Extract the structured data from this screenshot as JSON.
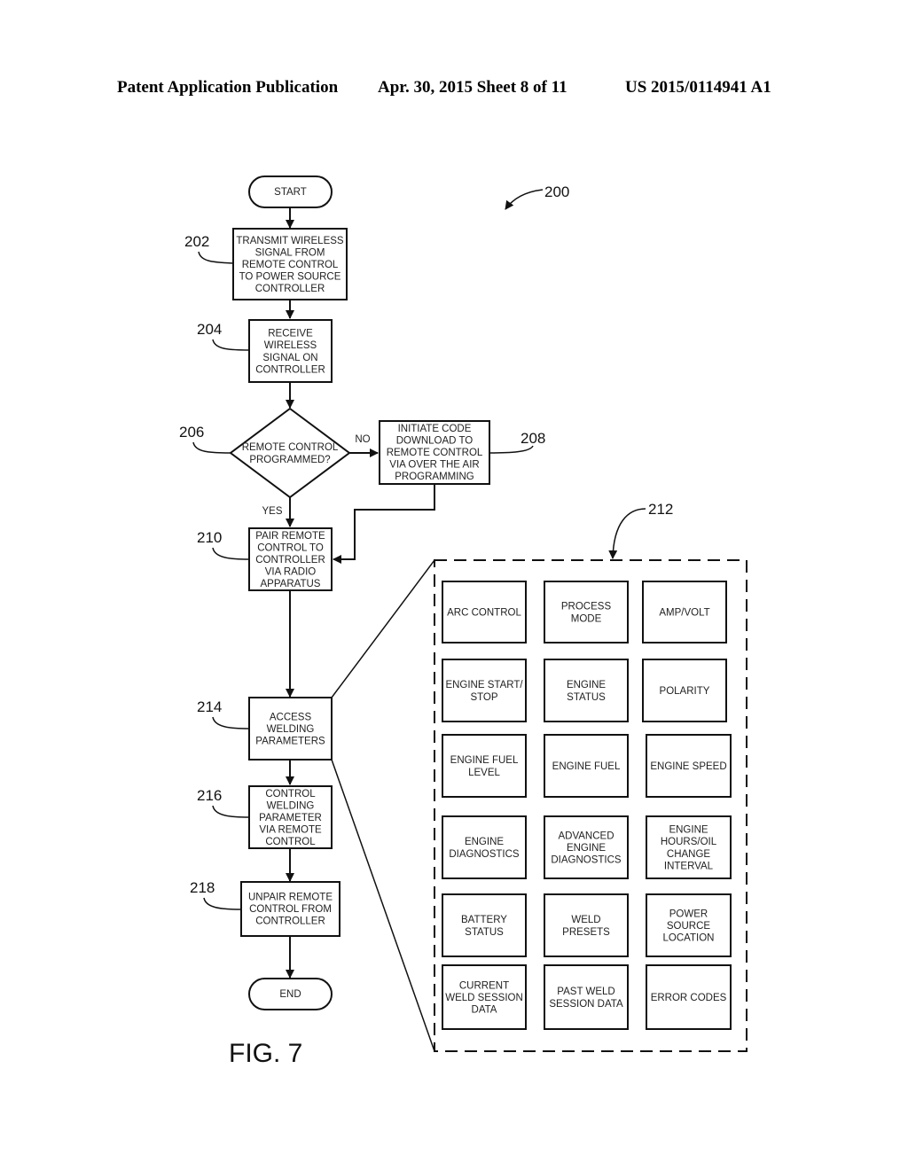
{
  "header": {
    "publication": "Patent Application Publication",
    "date_sheet": "Apr. 30, 2015  Sheet 8 of 11",
    "number": "US 2015/0114941 A1"
  },
  "figure": {
    "label": "FIG. 7",
    "ref": "200"
  },
  "flow": {
    "start": "START",
    "end": "END",
    "steps": [
      {
        "ref": "202",
        "lines": [
          "TRANSMIT WIRELESS",
          "SIGNAL FROM",
          "REMOTE CONTROL",
          "TO POWER SOURCE",
          "CONTROLLER"
        ]
      },
      {
        "ref": "204",
        "lines": [
          "RECEIVE",
          "WIRELESS",
          "SIGNAL ON",
          "CONTROLLER"
        ]
      },
      {
        "ref": "206",
        "lines": [
          "REMOTE CONTROL",
          "PROGRAMMED?"
        ]
      },
      {
        "ref": "208",
        "lines": [
          "INITIATE CODE",
          "DOWNLOAD TO",
          "REMOTE CONTROL",
          "VIA OVER THE AIR",
          "PROGRAMMING"
        ]
      },
      {
        "ref": "210",
        "lines": [
          "PAIR REMOTE",
          "CONTROL TO",
          "CONTROLLER",
          "VIA RADIO",
          "APPARATUS"
        ]
      },
      {
        "ref": "214",
        "lines": [
          "ACCESS",
          "WELDING",
          "PARAMETERS"
        ]
      },
      {
        "ref": "216",
        "lines": [
          "CONTROL",
          "WELDING",
          "PARAMETER",
          "VIA REMOTE",
          "CONTROL"
        ]
      },
      {
        "ref": "218",
        "lines": [
          "UNPAIR REMOTE",
          "CONTROL FROM",
          "CONTROLLER"
        ]
      }
    ],
    "yes_label": "YES",
    "no_label": "NO"
  },
  "parameters": {
    "ref": "212",
    "items": [
      [
        "ARC CONTROL"
      ],
      [
        "PROCESS",
        "MODE"
      ],
      [
        "AMP/VOLT"
      ],
      [
        "ENGINE START/",
        "STOP"
      ],
      [
        "ENGINE",
        "STATUS"
      ],
      [
        "POLARITY"
      ],
      [
        "ENGINE FUEL",
        "LEVEL"
      ],
      [
        "ENGINE FUEL"
      ],
      [
        "ENGINE SPEED"
      ],
      [
        "ENGINE",
        "DIAGNOSTICS"
      ],
      [
        "ADVANCED",
        "ENGINE",
        "DIAGNOSTICS"
      ],
      [
        "ENGINE",
        "HOURS/OIL",
        "CHANGE",
        "INTERVAL"
      ],
      [
        "BATTERY",
        "STATUS"
      ],
      [
        "WELD",
        "PRESETS"
      ],
      [
        "POWER",
        "SOURCE",
        "LOCATION"
      ],
      [
        "CURRENT",
        "WELD SESSION",
        "DATA"
      ],
      [
        "PAST WELD",
        "SESSION DATA"
      ],
      [
        "ERROR CODES"
      ]
    ]
  }
}
